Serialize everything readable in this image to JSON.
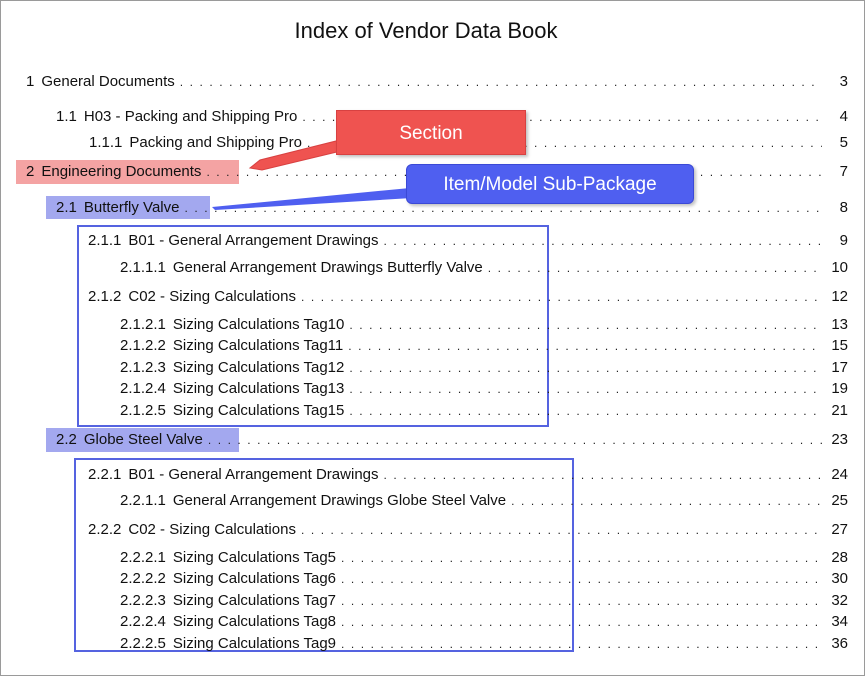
{
  "title": "Index of Vendor Data Book",
  "toc": [
    {
      "num": "1",
      "label": "General Documents",
      "page": "3"
    },
    {
      "num": "1.1",
      "label": "H03 - Packing and Shipping Pro",
      "page": "4"
    },
    {
      "num": "1.1.1",
      "label": "Packing and Shipping Pro",
      "page": "5"
    },
    {
      "num": "2",
      "label": "Engineering Documents",
      "page": "7"
    },
    {
      "num": "2.1",
      "label": "Butterfly Valve",
      "page": "8"
    },
    {
      "num": "2.1.1",
      "label": "B01 - General Arrangement Drawings",
      "page": "9"
    },
    {
      "num": "2.1.1.1",
      "label": "General Arrangement Drawings Butterfly Valve",
      "page": "10"
    },
    {
      "num": "2.1.2",
      "label": "C02 - Sizing Calculations",
      "page": "12"
    },
    {
      "num": "2.1.2.1",
      "label": "Sizing Calculations Tag10",
      "page": "13"
    },
    {
      "num": "2.1.2.2",
      "label": "Sizing Calculations Tag11",
      "page": "15"
    },
    {
      "num": "2.1.2.3",
      "label": "Sizing Calculations Tag12",
      "page": "17"
    },
    {
      "num": "2.1.2.4",
      "label": "Sizing Calculations Tag13",
      "page": "19"
    },
    {
      "num": "2.1.2.5",
      "label": "Sizing Calculations Tag15",
      "page": "21"
    },
    {
      "num": "2.2",
      "label": "Globe Steel Valve",
      "page": "23"
    },
    {
      "num": "2.2.1",
      "label": "B01 - General Arrangement Drawings",
      "page": "24"
    },
    {
      "num": "2.2.1.1",
      "label": "General Arrangement Drawings Globe Steel Valve",
      "page": "25"
    },
    {
      "num": "2.2.2",
      "label": "C02 - Sizing Calculations",
      "page": "27"
    },
    {
      "num": "2.2.2.1",
      "label": "Sizing Calculations Tag5",
      "page": "28"
    },
    {
      "num": "2.2.2.2",
      "label": "Sizing Calculations Tag6",
      "page": "30"
    },
    {
      "num": "2.2.2.3",
      "label": "Sizing Calculations Tag7",
      "page": "32"
    },
    {
      "num": "2.2.2.4",
      "label": "Sizing Calculations Tag8",
      "page": "34"
    },
    {
      "num": "2.2.2.5",
      "label": "Sizing Calculations Tag9",
      "page": "36"
    }
  ],
  "callouts": {
    "section": "Section",
    "sub_package": "Item/Model Sub-Package"
  },
  "colors": {
    "section_highlight": "#f4a3a3",
    "subpackage_highlight": "#a3a8ef",
    "box_border": "#5563e0",
    "callout_red": "#ef5350",
    "callout_blue": "#4f5ff0"
  }
}
